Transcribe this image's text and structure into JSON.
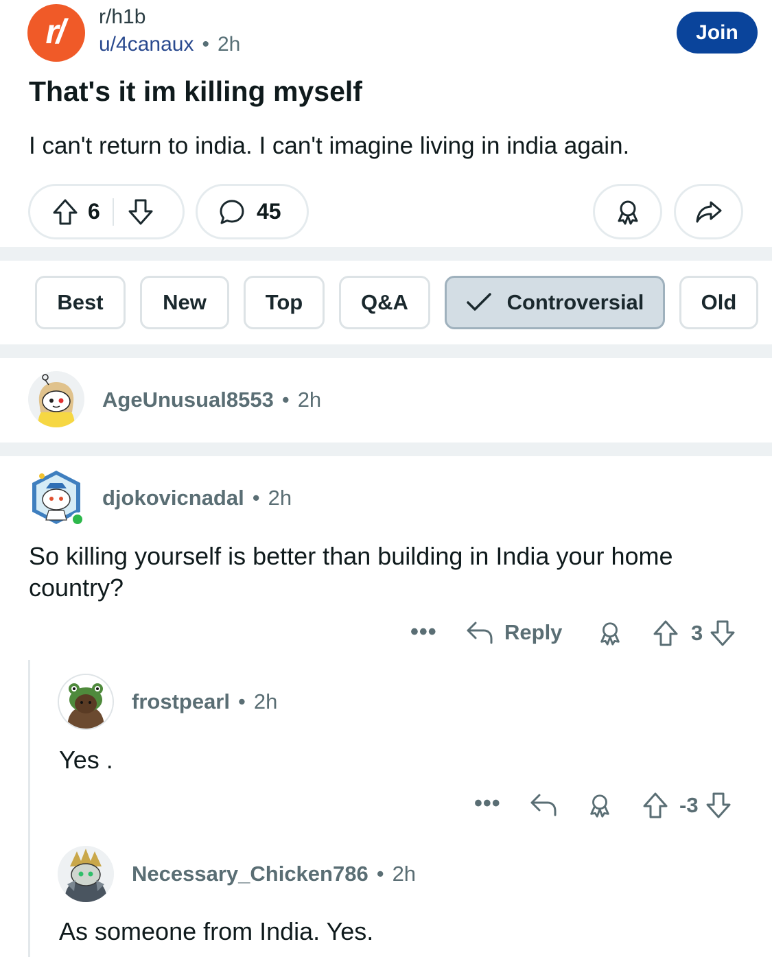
{
  "post": {
    "subreddit": "r/h1b",
    "subreddit_icon_text": "r/",
    "author": "u/4canaux",
    "age": "2h",
    "join_label": "Join",
    "title": "That's it im killing myself",
    "body": "I can't return to india. I can't imagine living in india again.",
    "score": "6",
    "comment_count": "45"
  },
  "sort": {
    "options": [
      "Best",
      "New",
      "Top",
      "Q&A",
      "Controversial",
      "Old"
    ],
    "selected": "Controversial"
  },
  "comments": [
    {
      "user": "AgeUnusual8553",
      "age": "2h"
    },
    {
      "user": "djokovicnadal",
      "age": "2h",
      "body": "So killing yourself is better than building in India your home country?",
      "reply_label": "Reply",
      "score": "3",
      "replies": [
        {
          "user": "frostpearl",
          "age": "2h",
          "body": "Yes .",
          "score": "-3"
        },
        {
          "user": "Necessary_Chicken786",
          "age": "2h",
          "body": "As someone from India. Yes."
        }
      ]
    }
  ],
  "colors": {
    "join_button": "#0a449b",
    "subreddit_icon": "#f05a28",
    "selected_chip": "#d3dde4"
  },
  "icons": [
    "upvote-icon",
    "downvote-icon",
    "comment-icon",
    "award-icon",
    "share-icon",
    "checkmark-icon",
    "reply-icon",
    "more-icon"
  ],
  "separator": "•"
}
